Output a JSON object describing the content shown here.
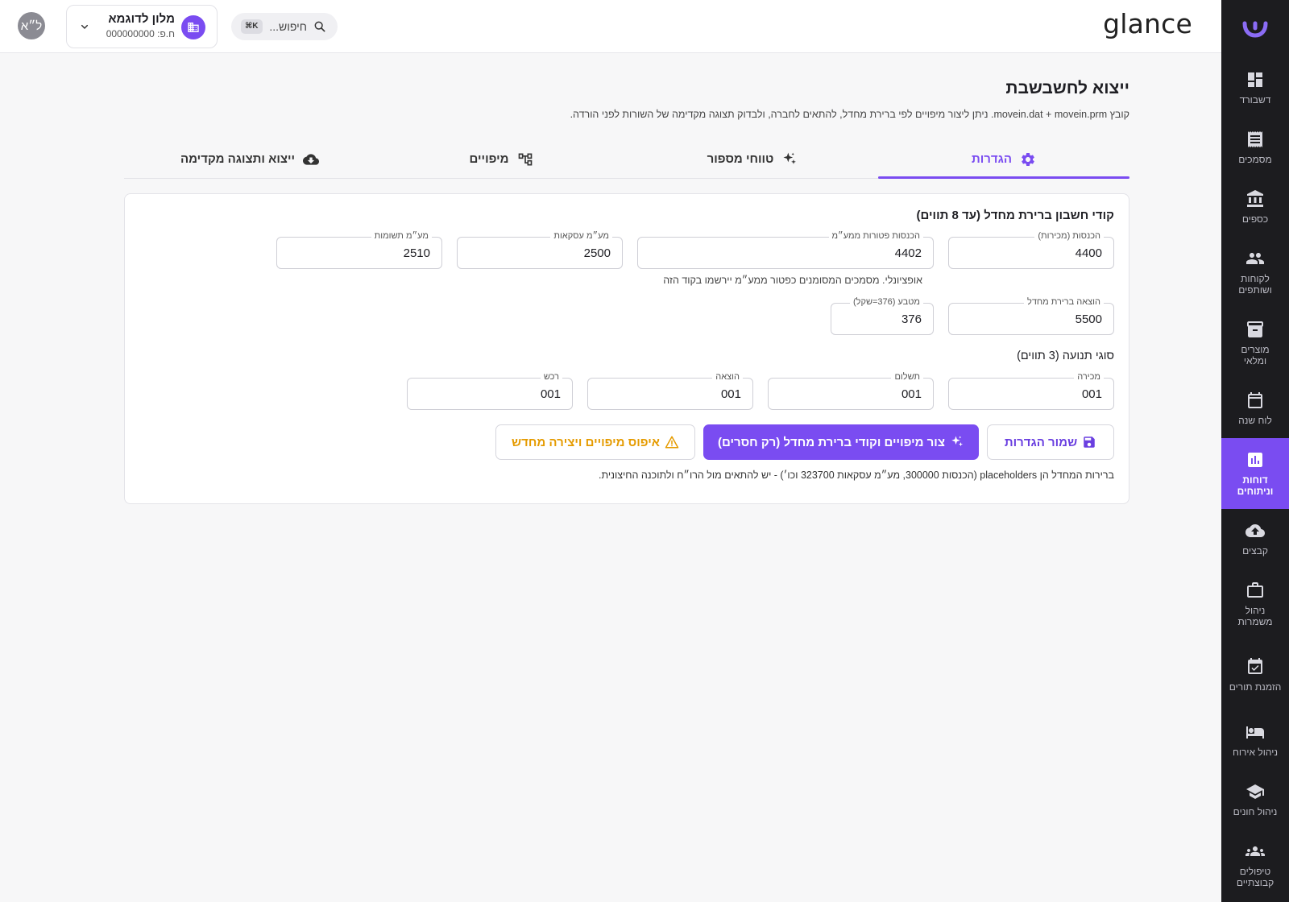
{
  "app": {
    "brand": "glance",
    "avatar_initials": "ל״א",
    "org": {
      "name": "מלון לדוגמא",
      "sub": "ח.פ: 000000000"
    },
    "search": {
      "placeholder": "חיפוש...",
      "shortcut": "⌘K"
    }
  },
  "sidebar": {
    "items": [
      {
        "label": "דשבורד",
        "icon": "dashboard-icon"
      },
      {
        "label": "מסמכים",
        "icon": "receipt-icon"
      },
      {
        "label": "כספים",
        "icon": "bank-icon"
      },
      {
        "label": "לקוחות ושותפים",
        "icon": "people-icon"
      },
      {
        "label": "מוצרים ומלאי",
        "icon": "archive-icon"
      },
      {
        "label": "לוח שנה",
        "icon": "calendar-icon"
      },
      {
        "label": "דוחות וניתוחים",
        "icon": "chart-icon",
        "active": true
      },
      {
        "label": "קבצים",
        "icon": "cloud-upload-icon"
      },
      {
        "label": "ניהול משמרות",
        "icon": "briefcase-icon"
      },
      {
        "label": "הזמנת תורים",
        "icon": "event-check-icon"
      },
      {
        "label": "ניהול אירוח",
        "icon": "bed-icon"
      },
      {
        "label": "ניהול חונים",
        "icon": "school-icon"
      },
      {
        "label": "טיפולים קבוצתיים",
        "icon": "groups-icon"
      }
    ]
  },
  "page": {
    "title": "ייצוא לחשבשבת",
    "description": "קובץ movein.dat + movein.prm. ניתן ליצור מיפויים לפי ברירת מחדל, להתאים לחברה, ולבדוק תצוגה מקדימה של השורות לפני הורדה."
  },
  "tabs": [
    {
      "label": "הגדרות",
      "icon": "gear-icon",
      "active": true
    },
    {
      "label": "טווחי מספור",
      "icon": "sparkle-icon"
    },
    {
      "label": "מיפויים",
      "icon": "hierarchy-icon"
    },
    {
      "label": "ייצוא ותצוגה מקדימה",
      "icon": "cloud-download-icon"
    }
  ],
  "settings": {
    "accounts_title": "קודי חשבון ברירת מחדל (עד 8 תווים)",
    "accounts": [
      {
        "label": "הכנסות (מכירות)",
        "value": "4400"
      },
      {
        "label": "הכנסות פטורות ממע״מ",
        "value": "4402"
      },
      {
        "label": "מע״מ עסקאות",
        "value": "2500"
      },
      {
        "label": "מע״מ תשומות",
        "value": "2510"
      }
    ],
    "exempt_hint": "אופציונלי. מסמכים המסומנים כפטור ממע״מ יירשמו בקוד הזה",
    "expense_default": {
      "label": "הוצאה ברירת מחדל",
      "value": "5500"
    },
    "currency": {
      "label": "מטבע (376=שקל)",
      "value": "376"
    },
    "movement_title": "סוגי תנועה (3 תווים)",
    "movements": [
      {
        "label": "מכירה",
        "value": "001"
      },
      {
        "label": "תשלום",
        "value": "001"
      },
      {
        "label": "הוצאה",
        "value": "001"
      },
      {
        "label": "רכש",
        "value": "001"
      }
    ],
    "buttons": {
      "save": "שמור הגדרות",
      "generate": "צור מיפויים וקודי ברירת מחדל (רק חסרים)",
      "reset": "איפוס מיפויים ויצירה מחדש"
    },
    "footnote": "ברירות המחדל הן placeholders (הכנסות 300000, מע״מ עסקאות 323700 וכו׳) - יש להתאים מול הרו״ח ולתוכנה החיצונית."
  },
  "colors": {
    "accent": "#7a4cf1",
    "sidebar_bg": "#1c1c1f",
    "warning": "#e59b00"
  }
}
